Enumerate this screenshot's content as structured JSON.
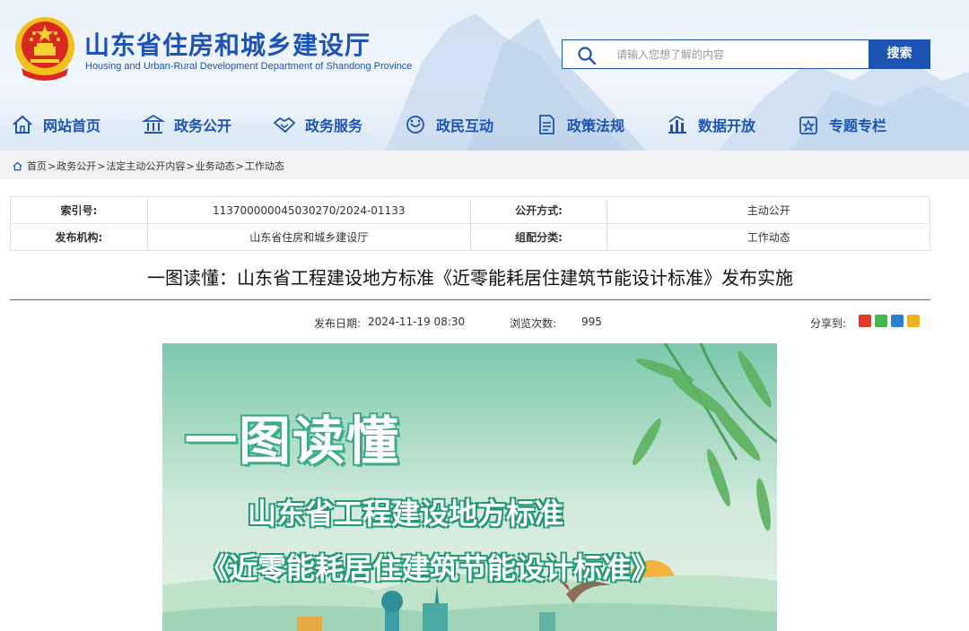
{
  "header": {
    "site_title": "山东省住房和城乡建设厅",
    "site_subtitle": "Housing and Urban-Rural Development Department of Shandong Province",
    "search_placeholder": "请输入您想了解的内容",
    "search_button": "搜索",
    "brand_color": "#1d53b3"
  },
  "nav": {
    "items": [
      {
        "label": "网站首页",
        "icon": "home-icon"
      },
      {
        "label": "政务公开",
        "icon": "government-building-icon"
      },
      {
        "label": "政务服务",
        "icon": "handshake-icon"
      },
      {
        "label": "政民互动",
        "icon": "interaction-icon"
      },
      {
        "label": "政策法规",
        "icon": "document-icon"
      },
      {
        "label": "数据开放",
        "icon": "chart-icon"
      },
      {
        "label": "专题专栏",
        "icon": "topic-icon"
      }
    ]
  },
  "breadcrumb": [
    "首页",
    "政务公开",
    "法定主动公开内容",
    "业务动态",
    "工作动态"
  ],
  "meta": {
    "index_label": "索引号:",
    "index_value": "113700000045030270/2024-01133",
    "publish_mode_label": "公开方式:",
    "publish_mode_value": "主动公开",
    "org_label": "发布机构:",
    "org_value": "山东省住房和城乡建设厅",
    "category_label": "组配分类:",
    "category_value": "工作动态"
  },
  "article": {
    "title": "一图读懂：山东省工程建设地方标准《近零能耗居住建筑节能设计标准》发布实施",
    "date_label": "发布日期:",
    "date_value": "2024-11-19 08:30",
    "views_label": "浏览次数:",
    "views_value": "995",
    "share_label": "分享到:",
    "share_icons": [
      "weibo-icon",
      "wechat-icon",
      "qq-icon",
      "qzone-icon"
    ]
  },
  "banner": {
    "line1": "一图读懂",
    "line2": "山东省工程建设地方标准",
    "line3": "《近零能耗居住建筑节能设计标准》"
  }
}
